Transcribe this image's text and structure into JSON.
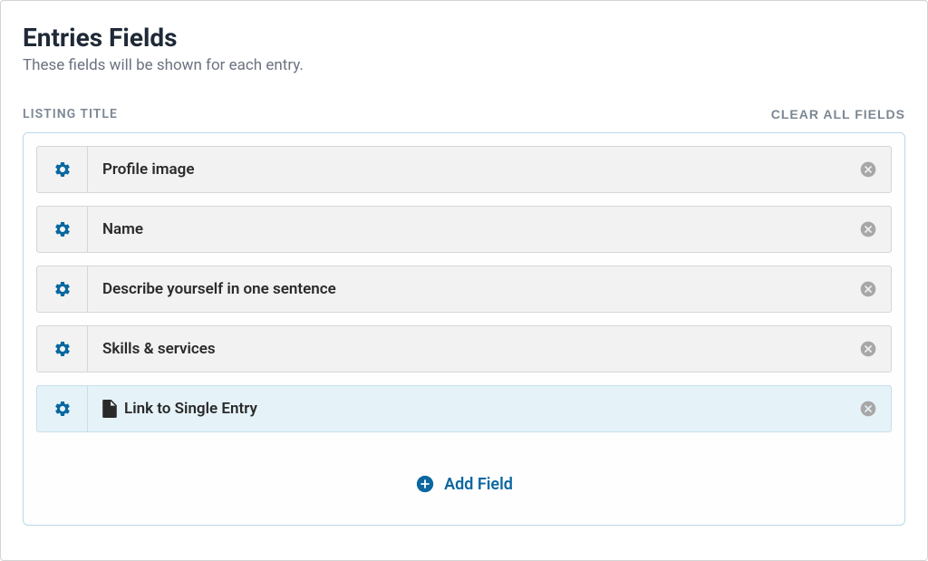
{
  "header": {
    "title": "Entries Fields",
    "subtitle": "These fields will be shown for each entry."
  },
  "section": {
    "label": "LISTING TITLE",
    "clear_all_label": "CLEAR ALL FIELDS"
  },
  "fields": [
    {
      "label": "Profile image",
      "highlighted": false,
      "show_doc_icon": false
    },
    {
      "label": "Name",
      "highlighted": false,
      "show_doc_icon": false
    },
    {
      "label": "Describe yourself in one sentence",
      "highlighted": false,
      "show_doc_icon": false
    },
    {
      "label": "Skills & services",
      "highlighted": false,
      "show_doc_icon": false
    },
    {
      "label": "Link to Single Entry",
      "highlighted": true,
      "show_doc_icon": true
    }
  ],
  "add_field_label": "Add Field"
}
